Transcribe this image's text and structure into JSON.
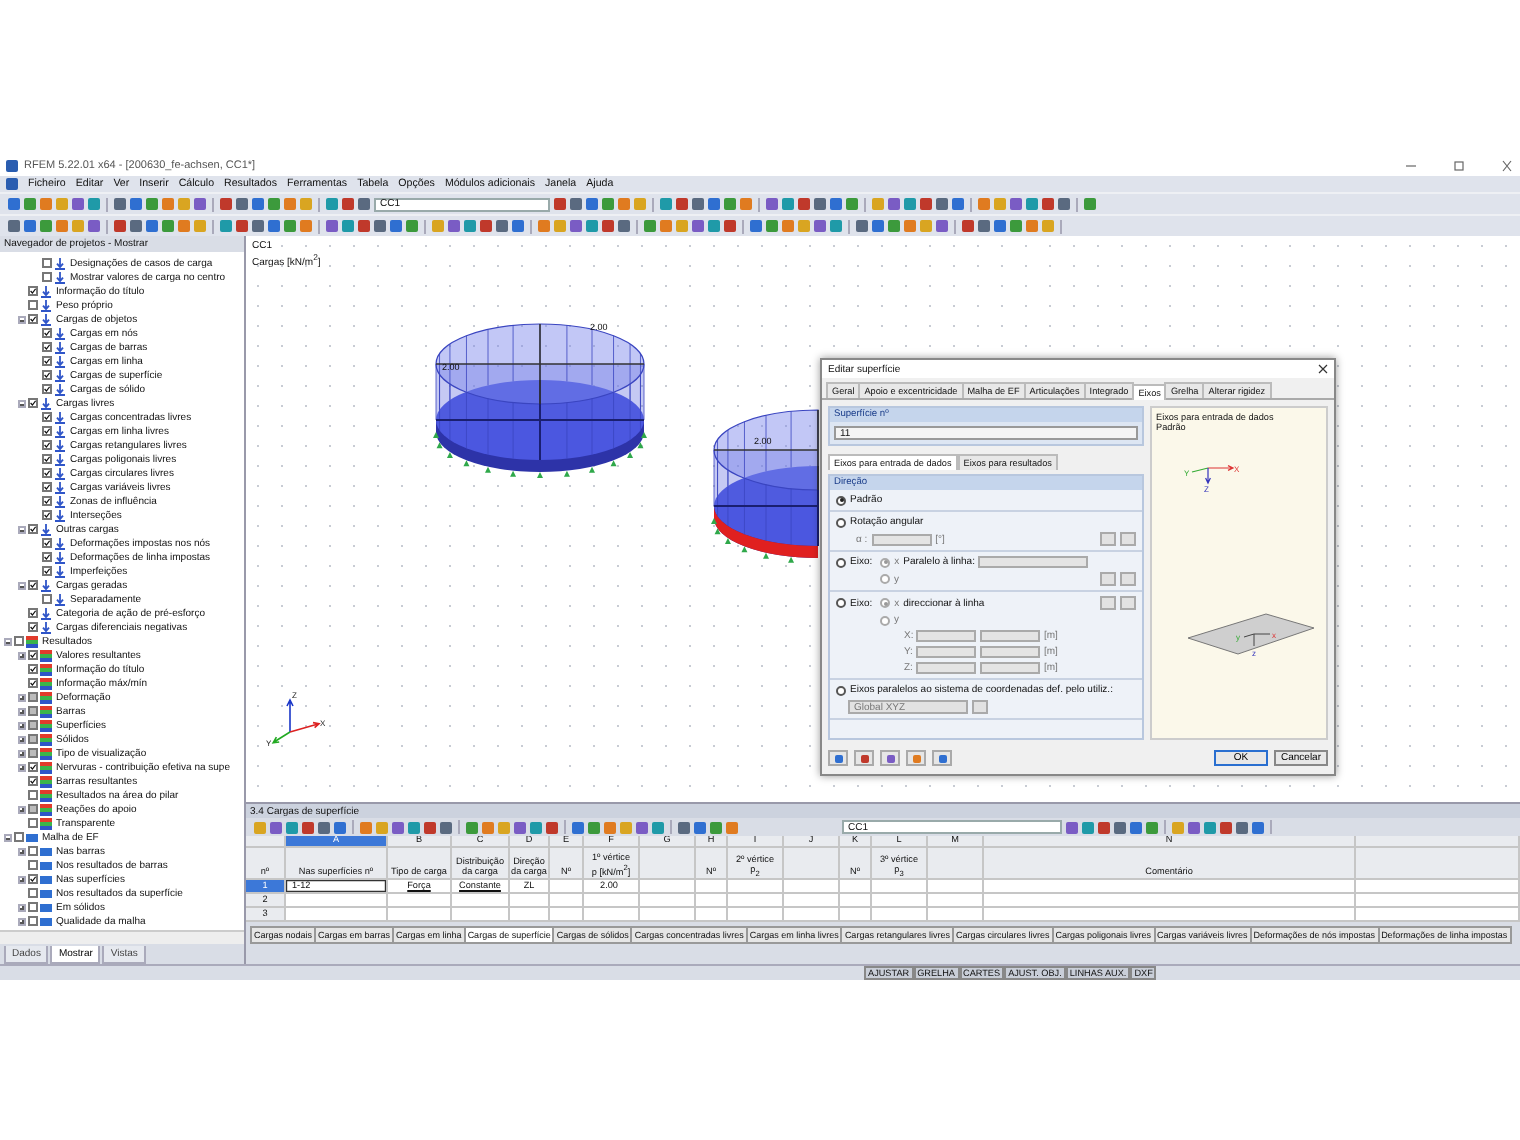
{
  "window": {
    "title": "RFEM 5.22.01 x64 - [200630_fe-achsen, CC1*]"
  },
  "menu": [
    "Ficheiro",
    "Editar",
    "Ver",
    "Inserir",
    "Cálculo",
    "Resultados",
    "Ferramentas",
    "Tabela",
    "Opções",
    "Módulos adicionais",
    "Janela",
    "Ajuda"
  ],
  "toolbar": {
    "load_case": "CC1"
  },
  "navigator": {
    "title": "Navegador de projetos - Mostrar",
    "scrolled_parent_children": [
      {
        "label": "Designações de casos de carga",
        "kind": "load",
        "checked": false
      },
      {
        "label": "Mostrar valores de carga no centro",
        "kind": "load",
        "checked": false
      }
    ],
    "continued_items": [
      {
        "label": "Informação do título",
        "kind": "load",
        "checked": true
      },
      {
        "label": "Peso próprio",
        "kind": "load",
        "checked": false
      },
      {
        "label": "Cargas de objetos",
        "kind": "load",
        "checked": true,
        "expanded": true,
        "children": [
          {
            "label": "Cargas em nós",
            "kind": "load",
            "checked": true
          },
          {
            "label": "Cargas de barras",
            "kind": "load",
            "checked": true
          },
          {
            "label": "Cargas em linha",
            "kind": "load",
            "checked": true
          },
          {
            "label": "Cargas de superfície",
            "kind": "load",
            "checked": true
          },
          {
            "label": "Cargas de sólido",
            "kind": "load",
            "checked": true
          }
        ]
      },
      {
        "label": "Cargas livres",
        "kind": "load",
        "checked": true,
        "expanded": true,
        "children": [
          {
            "label": "Cargas concentradas livres",
            "kind": "load",
            "checked": true
          },
          {
            "label": "Cargas em linha livres",
            "kind": "load",
            "checked": true
          },
          {
            "label": "Cargas retangulares livres",
            "kind": "load",
            "checked": true
          },
          {
            "label": "Cargas poligonais livres",
            "kind": "load",
            "checked": true
          },
          {
            "label": "Cargas circulares livres",
            "kind": "load",
            "checked": true
          },
          {
            "label": "Cargas variáveis livres",
            "kind": "load",
            "checked": true
          },
          {
            "label": "Zonas de influência",
            "kind": "load",
            "checked": true
          },
          {
            "label": "Interseções",
            "kind": "load",
            "checked": true
          }
        ]
      },
      {
        "label": "Outras cargas",
        "kind": "load",
        "checked": true,
        "expanded": true,
        "children": [
          {
            "label": "Deformações impostas nos nós",
            "kind": "load",
            "checked": true
          },
          {
            "label": "Deformações de linha impostas",
            "kind": "load",
            "checked": true
          },
          {
            "label": "Imperfeições",
            "kind": "load",
            "checked": true
          }
        ]
      },
      {
        "label": "Cargas geradas",
        "kind": "load",
        "checked": true,
        "expanded": true,
        "children": [
          {
            "label": "Separadamente",
            "kind": "load",
            "checked": false
          }
        ]
      },
      {
        "label": "Categoria de ação de pré-esforço",
        "kind": "load",
        "checked": true
      },
      {
        "label": "Cargas diferenciais negativas",
        "kind": "load",
        "checked": true
      }
    ],
    "items": [
      {
        "label": "Resultados",
        "kind": "results",
        "checked": false,
        "expanded": true,
        "children": [
          {
            "label": "Valores resultantes",
            "kind": "results",
            "checked": true,
            "indeterminate": false,
            "expanded": false
          },
          {
            "label": "Informação do título",
            "kind": "results",
            "checked": true,
            "indeterminate": false
          },
          {
            "label": "Informação máx/mín",
            "kind": "results",
            "checked": true,
            "indeterminate": false
          },
          {
            "label": "Deformação",
            "kind": "results",
            "checked": true,
            "indeterminate": true,
            "expanded": false
          },
          {
            "label": "Barras",
            "kind": "results",
            "checked": true,
            "indeterminate": true,
            "expanded": false
          },
          {
            "label": "Superfícies",
            "kind": "results",
            "checked": true,
            "indeterminate": true,
            "expanded": false
          },
          {
            "label": "Sólidos",
            "kind": "results",
            "checked": true,
            "indeterminate": true,
            "expanded": false
          },
          {
            "label": "Tipo de visualização",
            "kind": "results",
            "checked": true,
            "indeterminate": true,
            "expanded": false
          },
          {
            "label": "Nervuras - contribuição efetiva na supe",
            "kind": "results",
            "checked": true,
            "indeterminate": false,
            "expanded": false
          },
          {
            "label": "Barras resultantes",
            "kind": "results",
            "checked": true,
            "indeterminate": false
          },
          {
            "label": "Resultados na área do pilar",
            "kind": "results",
            "checked": false,
            "indeterminate": false
          },
          {
            "label": "Reações do apoio",
            "kind": "results",
            "checked": true,
            "indeterminate": true,
            "expanded": false
          },
          {
            "label": "Transparente",
            "kind": "results",
            "checked": false,
            "indeterminate": false
          }
        ]
      },
      {
        "label": "Malha de EF",
        "kind": "mesh",
        "checked": false,
        "expanded": true,
        "children": [
          {
            "label": "Nas barras",
            "kind": "mesh",
            "checked": false,
            "expanded": false
          },
          {
            "label": "Nos resultados de barras",
            "kind": "mesh",
            "checked": false
          },
          {
            "label": "Nas superfícies",
            "kind": "mesh",
            "checked": true,
            "expanded": false
          },
          {
            "label": "Nos resultados da superfície",
            "kind": "mesh",
            "checked": false
          },
          {
            "label": "Em sólidos",
            "kind": "mesh",
            "checked": false,
            "expanded": false
          },
          {
            "label": "Qualidade da malha",
            "kind": "mesh",
            "checked": false,
            "expanded": false
          }
        ]
      }
    ],
    "tabs": [
      {
        "label": "Dados",
        "selected": false
      },
      {
        "label": "Mostrar",
        "selected": true
      },
      {
        "label": "Vistas",
        "selected": false
      }
    ]
  },
  "viewport": {
    "load_case": "CC1",
    "caption": "Cargas [kN/m$^{2}$]",
    "load_labels": [
      "2.00",
      "2.00",
      "2.00"
    ],
    "axes": [
      "X",
      "Y",
      "Z"
    ]
  },
  "dialog": {
    "title": "Editar superfície",
    "tabs": [
      {
        "label": "Geral",
        "selected": false
      },
      {
        "label": "Apoio e excentricidade",
        "selected": false
      },
      {
        "label": "Malha de EF",
        "selected": false
      },
      {
        "label": "Articulações",
        "selected": false
      },
      {
        "label": "Integrado",
        "selected": false
      },
      {
        "label": "Eixos",
        "selected": true
      },
      {
        "label": "Grelha",
        "selected": false
      },
      {
        "label": "Alterar rigidez",
        "selected": false
      }
    ],
    "surface_label": "Superfície nº",
    "surface_value": "11",
    "subtabs": [
      {
        "label": "Eixos para entrada de dados",
        "selected": true
      },
      {
        "label": "Eixos para resultados",
        "selected": false
      }
    ],
    "group_title": "Direção",
    "options": [
      {
        "kind": "simple",
        "label": "Padrão",
        "selected": true
      },
      {
        "kind": "angle",
        "label": "Rotação angular",
        "selected": false,
        "field_label": "α :",
        "unit": "[°]"
      },
      {
        "kind": "parallel",
        "label": "Eixo:",
        "selected": false,
        "axes": [
          {
            "label": "x",
            "selected": true
          },
          {
            "label": "y",
            "selected": false
          }
        ],
        "text": "Paralelo à linha:"
      },
      {
        "kind": "direct",
        "label": "Eixo:",
        "selected": false,
        "axes": [
          {
            "label": "x",
            "selected": true
          },
          {
            "label": "y",
            "selected": false
          }
        ],
        "text": "direccionar à linha",
        "coords": [
          {
            "label": "X:",
            "unit": "[m]"
          },
          {
            "label": "Y:",
            "unit": "[m]"
          },
          {
            "label": "Z:",
            "unit": "[m]"
          }
        ]
      },
      {
        "kind": "user",
        "label": "Eixos paralelos ao sistema de coordenadas def. pelo utiliz.:",
        "selected": false,
        "dropdown": "Global XYZ"
      }
    ],
    "preview": {
      "heading": "Eixos para entrada de dados",
      "subheading": "Padrão",
      "axis_labels": [
        "Y",
        "X",
        "Z"
      ],
      "plane_labels": [
        "y",
        "x",
        "z"
      ]
    },
    "buttons": [
      "OK",
      "Cancelar"
    ]
  },
  "table": {
    "title": "3.4 Cargas de superfície",
    "load_case": "CC1",
    "row_header": "nº",
    "columns": [
      {
        "letter": "A",
        "heading": "Nas superfícies nº",
        "selected": true
      },
      {
        "letter": "B",
        "heading": "Tipo de carga",
        "selected": false
      },
      {
        "letter": "C",
        "heading": "Distribuição da carga",
        "selected": false
      },
      {
        "letter": "D",
        "heading": "Direção da carga",
        "selected": false
      },
      {
        "letter": "E",
        "heading": "Nº",
        "selected": false
      },
      {
        "letter": "F",
        "group": "1º vértice",
        "heading": "p [kN/m$^{2}$]",
        "selected": false
      },
      {
        "letter": "G",
        "selected": false
      },
      {
        "letter": "H",
        "heading": "Nº",
        "selected": false
      },
      {
        "letter": "I",
        "group": "2º vértice",
        "heading": "p$_{2}$",
        "selected": false
      },
      {
        "letter": "J",
        "selected": false
      },
      {
        "letter": "K",
        "heading": "Nº",
        "selected": false
      },
      {
        "letter": "L",
        "group": "3º vértice",
        "heading": "p$_{3}$",
        "selected": false
      },
      {
        "letter": "M",
        "selected": false
      },
      {
        "letter": "N",
        "heading": "Comentário",
        "selected": false
      }
    ],
    "rows": [
      {
        "number": "1",
        "selected": true,
        "cells": {
          "A": "1-12",
          "B": "Força",
          "C": "Constante",
          "D": "ZL",
          "F": "2.00"
        }
      },
      {
        "number": "2",
        "selected": false
      },
      {
        "number": "3",
        "selected": false
      }
    ],
    "sheets": [
      {
        "label": "Cargas nodais",
        "selected": false
      },
      {
        "label": "Cargas em barras",
        "selected": false
      },
      {
        "label": "Cargas em linha",
        "selected": false
      },
      {
        "label": "Cargas de superfície",
        "selected": true
      },
      {
        "label": "Cargas de sólidos",
        "selected": false
      },
      {
        "label": "Cargas concentradas livres",
        "selected": false
      },
      {
        "label": "Cargas em linha livres",
        "selected": false
      },
      {
        "label": "Cargas retangulares livres",
        "selected": false
      },
      {
        "label": "Cargas circulares livres",
        "selected": false
      },
      {
        "label": "Cargas poligonais livres",
        "selected": false
      },
      {
        "label": "Cargas variáveis livres",
        "selected": false
      },
      {
        "label": "Deformações de nós impostas",
        "selected": false
      },
      {
        "label": "Deformações de linha impostas",
        "selected": false
      }
    ]
  },
  "status_bar": [
    "AJUSTAR",
    "GRELHA",
    "CARTES",
    "AJUST. OBJ.",
    "LINHAS AUX.",
    "DXF"
  ]
}
